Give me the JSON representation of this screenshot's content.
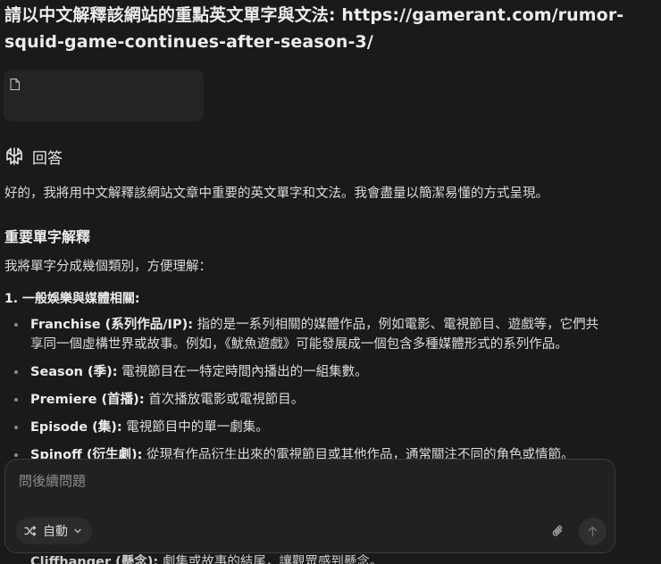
{
  "query": {
    "prefix": "請以中文解釋該網站的重點英文單字與文法: ",
    "url_line1": "https://gamerant.com/rumor-",
    "url_line2": "squid-game-continues-after-season-3/"
  },
  "answer_header": {
    "label": "回答",
    "icon": "perplexity-logo-icon"
  },
  "intro": "好的，我將用中文解釋該網站文章中重要的英文單字和文法。我會盡量以簡潔易懂的方式呈現。",
  "section_title": "重要單字解釋",
  "section_desc": "我將單字分成幾個類別，方便理解：",
  "subsection_title": "1. 一般娛樂與媒體相關:",
  "bullets": [
    {
      "term": "Franchise (系列作品/IP):",
      "line1": " 指的是一系列相關的媒體作品，例如電影、電視節目、遊戲等，它們共",
      "line2": "享同一個虛構世界或故事。例如，《魷魚遊戲》可能發展成一個包含多種媒體形式的系列作品。"
    },
    {
      "term": "Season (季):",
      "line1": " 電視節目在一特定時間內播出的一組集數。"
    },
    {
      "term": "Premiere (首播):",
      "line1": " 首次播放電影或電視節目。"
    },
    {
      "term": "Episode (集):",
      "line1": " 電視節目中的單一劇集。"
    },
    {
      "term": "Spinoff (衍生劇):",
      "line1": " 從現有作品衍生出來的電視節目或其他作品，通常關注不同的角色或情節。"
    }
  ],
  "hidden_bullet": {
    "term": "Cliffhanger (懸念):",
    "text": " 劇集或故事的結尾，讓觀眾感到懸念。"
  },
  "composer": {
    "placeholder": "問後續問題",
    "mode_label": "自動",
    "mode_icon": "shuffle-icon",
    "attach_icon": "paperclip-icon",
    "send_icon": "arrow-up-icon"
  }
}
